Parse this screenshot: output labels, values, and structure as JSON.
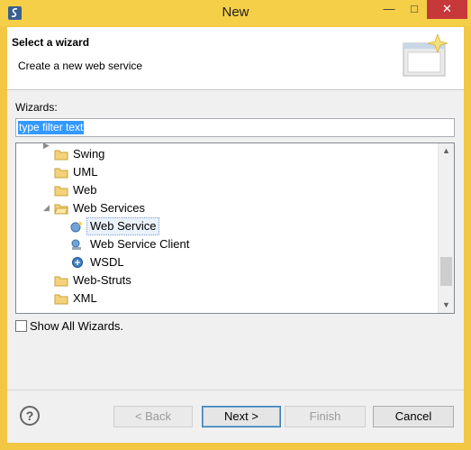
{
  "window": {
    "title": "New"
  },
  "header": {
    "title": "Select a wizard",
    "description": "Create a new web service"
  },
  "wizards_label": "Wizards:",
  "filter": {
    "value": "type filter text"
  },
  "tree": {
    "items": [
      {
        "label": "Swing",
        "type": "folder"
      },
      {
        "label": "UML",
        "type": "folder"
      },
      {
        "label": "Web",
        "type": "folder"
      },
      {
        "label": "Web Services",
        "type": "folder",
        "expanded": true
      },
      {
        "label": "Web Service",
        "type": "wizard",
        "selected": true
      },
      {
        "label": "Web Service Client",
        "type": "wizard"
      },
      {
        "label": "WSDL",
        "type": "wizard"
      },
      {
        "label": "Web-Struts",
        "type": "folder"
      },
      {
        "label": "XML",
        "type": "folder"
      }
    ]
  },
  "show_all": {
    "label": "Show All Wizards.",
    "checked": false
  },
  "buttons": {
    "back": "< Back",
    "next": "Next >",
    "finish": "Finish",
    "cancel": "Cancel"
  },
  "colors": {
    "title_bar": "#f5cf47",
    "close": "#c7383a",
    "selection": "#3399ff"
  }
}
